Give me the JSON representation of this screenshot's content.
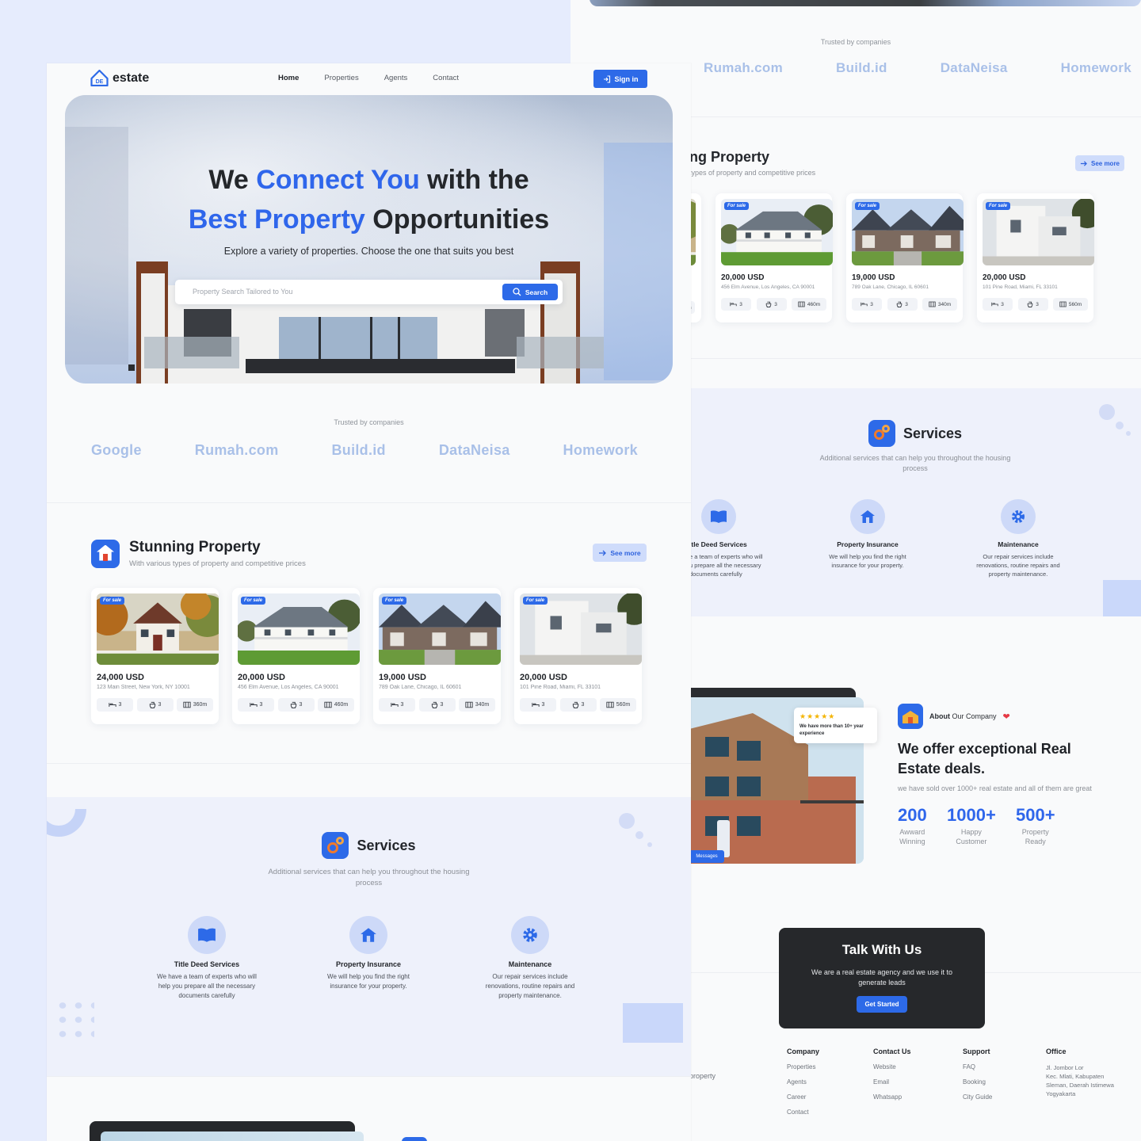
{
  "colors": {
    "accent": "#2d6ae8",
    "dark": "#26282b",
    "background": "#e6ecfd"
  },
  "brand": {
    "name": "estate",
    "mark": "DE"
  },
  "nav": {
    "items": [
      "Home",
      "Properties",
      "Agents",
      "Contact"
    ],
    "signin": "Sign in"
  },
  "hero": {
    "title_part1": "We ",
    "title_highlight1": "Connect You",
    "title_part2": " with the",
    "title_highlight2": "Best Property",
    "title_part3": " Opportunities",
    "subtitle": "Explore a variety of properties. Choose the one that suits you best",
    "search_placeholder": "Property Search Tailored to You",
    "search_button": "Search"
  },
  "trusted": {
    "label": "Trusted by companies",
    "companies": [
      "Google",
      "Rumah.com",
      "Build.id",
      "DataNeisa",
      "Homework"
    ]
  },
  "property_section": {
    "title": "Stunning Property",
    "title_partial": "ng Property",
    "subtitle": "With various types of property and competitive prices",
    "subtitle_partial": "types of property and competitive prices",
    "see_more": "See more",
    "badge": "For sale",
    "cards": [
      {
        "price": "24,000 USD",
        "address": "123 Main Street, New York, NY 10001",
        "beds": "3",
        "baths": "3",
        "area": "360m"
      },
      {
        "price": "20,000 USD",
        "address": "456 Elm Avenue, Los Angeles, CA 90001",
        "beds": "3",
        "baths": "3",
        "area": "460m"
      },
      {
        "price": "19,000 USD",
        "address": "789 Oak Lane, Chicago, IL 60601",
        "beds": "3",
        "baths": "3",
        "area": "340m"
      },
      {
        "price": "20,000 USD",
        "address": "101 Pine Road, Miami, FL 33101",
        "beds": "3",
        "baths": "3",
        "area": "560m"
      }
    ],
    "partial_card": {
      "address": "NY 10001",
      "area": "360m"
    }
  },
  "services": {
    "title": "Services",
    "subtitle_line1": "Additional services that can help you throughout the housing",
    "subtitle_line2": "process",
    "items": [
      {
        "name": "Title Deed Services",
        "name_partial": "itle Deed Services",
        "desc1": "We have a team of experts who will",
        "desc2": "help you prepare all the necessary",
        "desc3": "documents carefully",
        "pdesc1": "e a team of experts who will",
        "pdesc2": "u prepare all the necessary",
        "pdesc3": "documents carefully"
      },
      {
        "name": "Property Insurance",
        "desc1": "We will help you find the right",
        "desc2": "insurance for your property."
      },
      {
        "name": "Maintenance",
        "desc1": "Our repair services include",
        "desc2": "renovations, routine repairs and",
        "desc3": "property maintenance."
      }
    ]
  },
  "about": {
    "label_bold": "About",
    "label_rest": " Our Company",
    "review_stars": "★★★★★",
    "review_text": "We have more than 10+ year experience",
    "messages": "Messages",
    "title_line1": "We offer exceptional Real",
    "title_line2": "Estate deals.",
    "subtitle": "we have sold over 1000+ real estate and all of them are great",
    "stats": [
      {
        "num": "200",
        "l1": "Awward",
        "l2": "Winning"
      },
      {
        "num": "1000+",
        "l1": "Happy",
        "l2": "Customer"
      },
      {
        "num": "500+",
        "l1": "Property",
        "l2": "Ready"
      }
    ]
  },
  "talk": {
    "title": "Talk With Us",
    "line1": "We are a real estate agency and we use it to",
    "line2": "generate leads",
    "button": "Get Started"
  },
  "footer": {
    "left_partial": "property",
    "company": {
      "h": "Company",
      "items": [
        "Properties",
        "Agents",
        "Career",
        "Contact"
      ]
    },
    "contact": {
      "h": "Contact Us",
      "items": [
        "Website",
        "Email",
        "Whatsapp"
      ]
    },
    "support": {
      "h": "Support",
      "items": [
        "FAQ",
        "Booking",
        "City Guide"
      ]
    },
    "office": {
      "h": "Office",
      "l1": "Jl. Jombor Lor",
      "l2": "Kec. Mlati, Kabupaten",
      "l3": "Sleman, Daerah Istimewa",
      "l4": "Yogyakarta"
    }
  }
}
